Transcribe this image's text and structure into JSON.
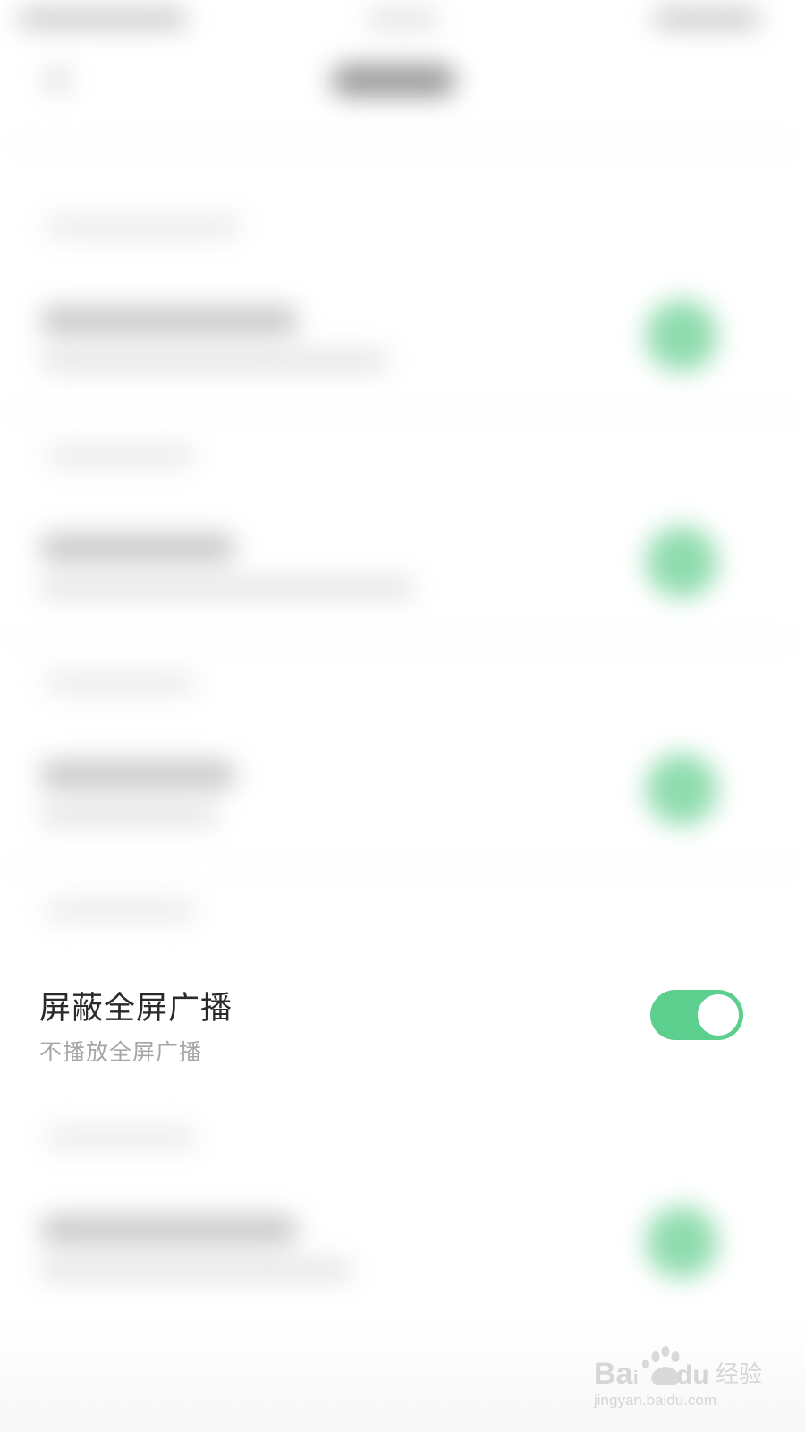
{
  "settings": {
    "focused_row": {
      "title": "屏蔽全屏广播",
      "subtitle": "不播放全屏广播",
      "toggle_on": true
    }
  },
  "colors": {
    "toggle_on": "#5ccf8e",
    "title_text": "#2a2a2a",
    "subtitle_text": "#a6a6a6",
    "background": "#ffffff"
  },
  "watermark": {
    "brand": "Baidu经验",
    "url": "jingyan.baidu.com"
  },
  "icons": {
    "back": "back-arrow-icon",
    "toggle_knob": "toggle-knob"
  }
}
